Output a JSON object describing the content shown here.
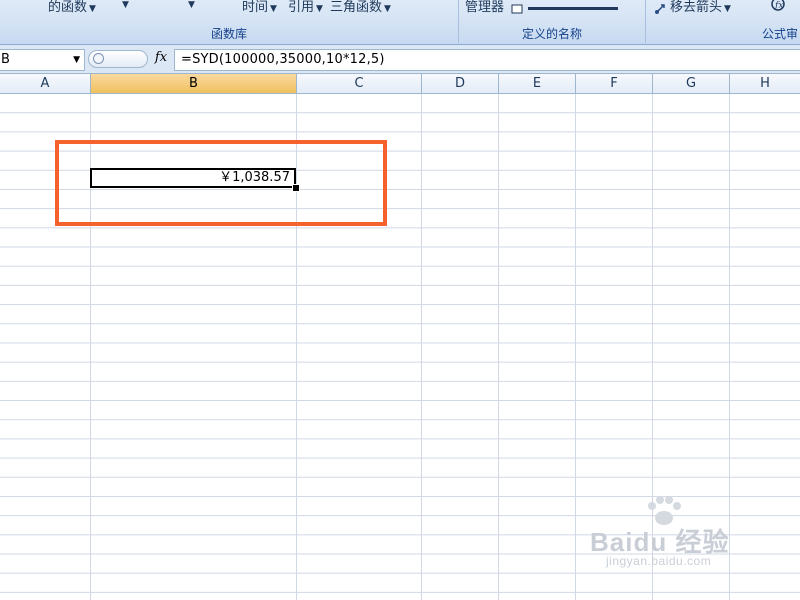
{
  "ribbon": {
    "groups": [
      {
        "label": "函数库"
      },
      {
        "label": "定义的名称"
      },
      {
        "label": "公式审"
      }
    ],
    "items": {
      "func_partial": "的函数",
      "datetime": "时间",
      "lookup": "引用",
      "trig": "三角函数",
      "name_manager": "管理器",
      "remove_arrows": "移去箭头"
    }
  },
  "formula_bar": {
    "name_box": "B",
    "fx_label": "fx",
    "formula": "=SYD(100000,35000,10*12,5)"
  },
  "columns": [
    "A",
    "B",
    "C",
    "D",
    "E",
    "F",
    "G",
    "H"
  ],
  "selected_column": "B",
  "cell": {
    "value": "￥1,038.57"
  },
  "watermark": {
    "logo": "Baidu 经验",
    "url": "jingyan.baidu.com"
  },
  "colors": {
    "highlight_box": "#f5622d",
    "ribbon": "#d3e2f4",
    "active_header": "#f1c15f"
  }
}
